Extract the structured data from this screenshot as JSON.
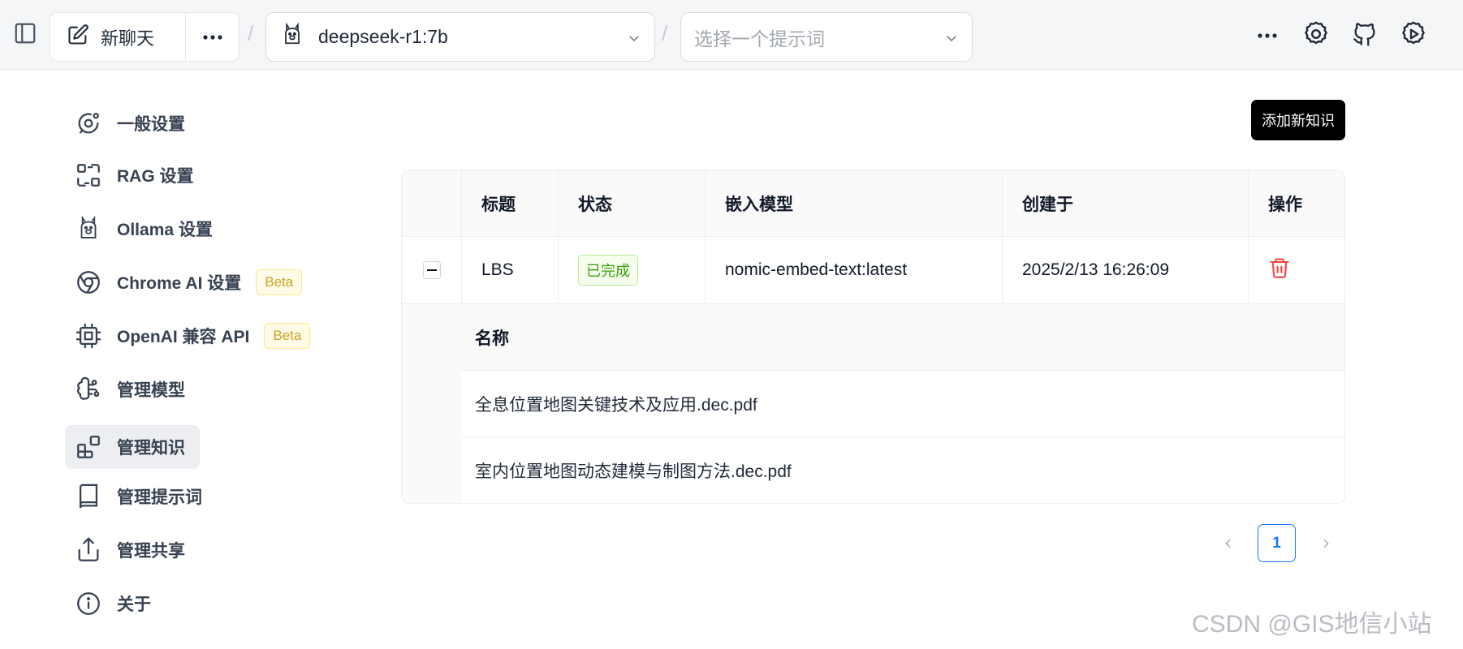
{
  "topbar": {
    "new_chat_label": "新聊天",
    "model_value": "deepseek-r1:7b",
    "prompt_placeholder": "选择一个提示词",
    "separator": "/"
  },
  "sidebar": {
    "items": [
      {
        "label": "一般设置",
        "icon": "general-settings-icon"
      },
      {
        "label": "RAG 设置",
        "icon": "rag-icon"
      },
      {
        "label": "Ollama 设置",
        "icon": "ollama-llama-icon"
      },
      {
        "label": "Chrome AI 设置",
        "icon": "chrome-icon",
        "badge": "Beta"
      },
      {
        "label": "OpenAI 兼容 API",
        "icon": "cpu-chip-icon",
        "badge": "Beta"
      },
      {
        "label": "管理模型",
        "icon": "brain-icon"
      },
      {
        "label": "管理知识",
        "icon": "blocks-icon",
        "active": true
      },
      {
        "label": "管理提示词",
        "icon": "book-icon"
      },
      {
        "label": "管理共享",
        "icon": "share-icon"
      },
      {
        "label": "关于",
        "icon": "info-icon"
      }
    ]
  },
  "main": {
    "add_button": "添加新知识",
    "table": {
      "headers": [
        "标题",
        "状态",
        "嵌入模型",
        "创建于",
        "操作"
      ],
      "rows": [
        {
          "title": "LBS",
          "status": "已完成",
          "embedding_model": "nomic-embed-text:latest",
          "created_at": "2025/2/13 16:26:09"
        }
      ],
      "expanded": {
        "header": "名称",
        "files": [
          "全息位置地图关键技术及应用.dec.pdf",
          "室内位置地图动态建模与制图方法.dec.pdf"
        ]
      }
    },
    "pagination": {
      "current": "1"
    }
  },
  "watermark": "CSDN @GIS地信小站",
  "colors": {
    "accent": "#1677ff",
    "status_success": "#389e0d",
    "danger": "#ef4444",
    "beta": "#c9a227"
  }
}
